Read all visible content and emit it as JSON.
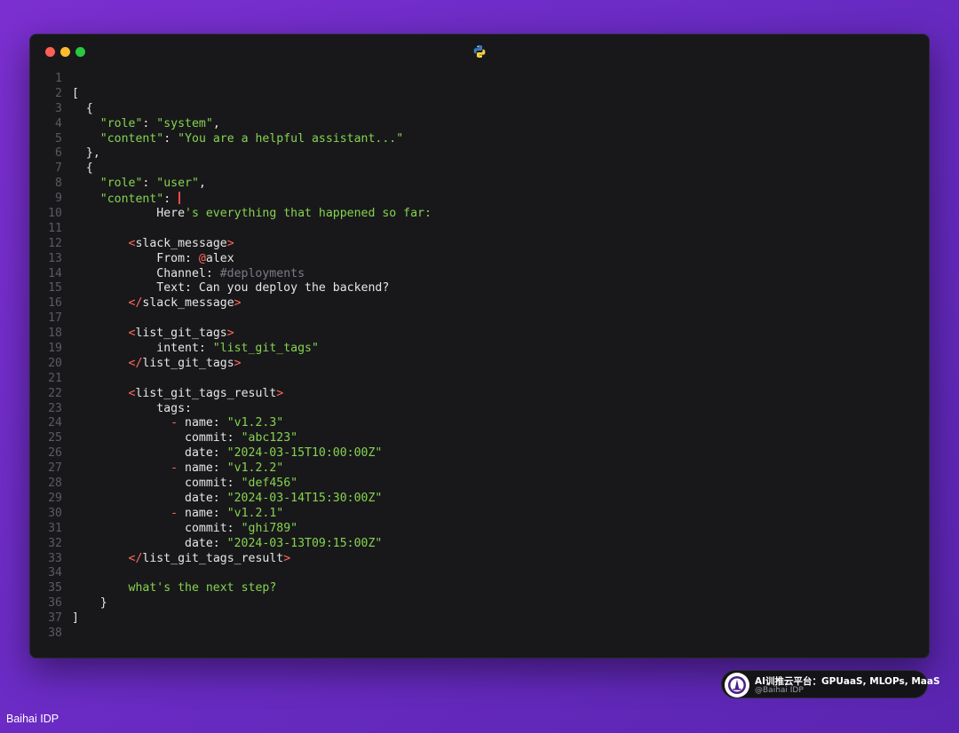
{
  "window": {
    "file_icon": "python-icon"
  },
  "code_lines": [
    {
      "n": "1",
      "parts": []
    },
    {
      "n": "2",
      "parts": [
        {
          "c": "p",
          "t": "["
        }
      ]
    },
    {
      "n": "3",
      "parts": [
        {
          "c": "p",
          "t": "  {"
        }
      ]
    },
    {
      "n": "4",
      "parts": [
        {
          "c": "p",
          "t": "    "
        },
        {
          "c": "k",
          "t": "\"role\""
        },
        {
          "c": "p",
          "t": ": "
        },
        {
          "c": "s",
          "t": "\"system\""
        },
        {
          "c": "p",
          "t": ","
        }
      ]
    },
    {
      "n": "5",
      "parts": [
        {
          "c": "p",
          "t": "    "
        },
        {
          "c": "k",
          "t": "\"content\""
        },
        {
          "c": "p",
          "t": ": "
        },
        {
          "c": "s",
          "t": "\"You are a helpful assistant...\""
        }
      ]
    },
    {
      "n": "6",
      "parts": [
        {
          "c": "p",
          "t": "  },"
        }
      ]
    },
    {
      "n": "7",
      "parts": [
        {
          "c": "p",
          "t": "  {"
        }
      ]
    },
    {
      "n": "8",
      "parts": [
        {
          "c": "p",
          "t": "    "
        },
        {
          "c": "k",
          "t": "\"role\""
        },
        {
          "c": "p",
          "t": ": "
        },
        {
          "c": "s",
          "t": "\"user\""
        },
        {
          "c": "p",
          "t": ","
        }
      ]
    },
    {
      "n": "9",
      "parts": [
        {
          "c": "p",
          "t": "    "
        },
        {
          "c": "k",
          "t": "\"content\""
        },
        {
          "c": "p",
          "t": ": "
        },
        {
          "c": "cursor",
          "t": ""
        }
      ]
    },
    {
      "n": "10",
      "parts": [
        {
          "c": "p",
          "t": "            Here"
        },
        {
          "c": "s",
          "t": "'s everything that happened so far:"
        }
      ]
    },
    {
      "n": "11",
      "parts": []
    },
    {
      "n": "12",
      "parts": [
        {
          "c": "p",
          "t": "        "
        },
        {
          "c": "t",
          "t": "<"
        },
        {
          "c": "p",
          "t": "slack_message"
        },
        {
          "c": "t",
          "t": ">"
        }
      ]
    },
    {
      "n": "13",
      "parts": [
        {
          "c": "p",
          "t": "            From: "
        },
        {
          "c": "t",
          "t": "@"
        },
        {
          "c": "p",
          "t": "alex"
        }
      ]
    },
    {
      "n": "14",
      "parts": [
        {
          "c": "p",
          "t": "            Channel: "
        },
        {
          "c": "cm",
          "t": "#deployments"
        }
      ]
    },
    {
      "n": "15",
      "parts": [
        {
          "c": "p",
          "t": "            Text: Can you deploy the backend?"
        }
      ]
    },
    {
      "n": "16",
      "parts": [
        {
          "c": "p",
          "t": "        "
        },
        {
          "c": "t",
          "t": "</"
        },
        {
          "c": "p",
          "t": "slack_message"
        },
        {
          "c": "t",
          "t": ">"
        }
      ]
    },
    {
      "n": "17",
      "parts": []
    },
    {
      "n": "18",
      "parts": [
        {
          "c": "p",
          "t": "        "
        },
        {
          "c": "t",
          "t": "<"
        },
        {
          "c": "p",
          "t": "list_git_tags"
        },
        {
          "c": "t",
          "t": ">"
        }
      ]
    },
    {
      "n": "19",
      "parts": [
        {
          "c": "p",
          "t": "            intent: "
        },
        {
          "c": "s",
          "t": "\"list_git_tags\""
        }
      ]
    },
    {
      "n": "20",
      "parts": [
        {
          "c": "p",
          "t": "        "
        },
        {
          "c": "t",
          "t": "</"
        },
        {
          "c": "p",
          "t": "list_git_tags"
        },
        {
          "c": "t",
          "t": ">"
        }
      ]
    },
    {
      "n": "21",
      "parts": []
    },
    {
      "n": "22",
      "parts": [
        {
          "c": "p",
          "t": "        "
        },
        {
          "c": "t",
          "t": "<"
        },
        {
          "c": "p",
          "t": "list_git_tags_result"
        },
        {
          "c": "t",
          "t": ">"
        }
      ]
    },
    {
      "n": "23",
      "parts": [
        {
          "c": "p",
          "t": "            tags:"
        }
      ]
    },
    {
      "n": "24",
      "parts": [
        {
          "c": "p",
          "t": "              "
        },
        {
          "c": "t",
          "t": "-"
        },
        {
          "c": "p",
          "t": " name: "
        },
        {
          "c": "s",
          "t": "\"v1.2.3\""
        }
      ]
    },
    {
      "n": "25",
      "parts": [
        {
          "c": "p",
          "t": "                commit: "
        },
        {
          "c": "s",
          "t": "\"abc123\""
        }
      ]
    },
    {
      "n": "26",
      "parts": [
        {
          "c": "p",
          "t": "                date: "
        },
        {
          "c": "s",
          "t": "\"2024-03-15T10:00:00Z\""
        }
      ]
    },
    {
      "n": "27",
      "parts": [
        {
          "c": "p",
          "t": "              "
        },
        {
          "c": "t",
          "t": "-"
        },
        {
          "c": "p",
          "t": " name: "
        },
        {
          "c": "s",
          "t": "\"v1.2.2\""
        }
      ]
    },
    {
      "n": "28",
      "parts": [
        {
          "c": "p",
          "t": "                commit: "
        },
        {
          "c": "s",
          "t": "\"def456\""
        }
      ]
    },
    {
      "n": "29",
      "parts": [
        {
          "c": "p",
          "t": "                date: "
        },
        {
          "c": "s",
          "t": "\"2024-03-14T15:30:00Z\""
        }
      ]
    },
    {
      "n": "30",
      "parts": [
        {
          "c": "p",
          "t": "              "
        },
        {
          "c": "t",
          "t": "-"
        },
        {
          "c": "p",
          "t": " name: "
        },
        {
          "c": "s",
          "t": "\"v1.2.1\""
        }
      ]
    },
    {
      "n": "31",
      "parts": [
        {
          "c": "p",
          "t": "                commit: "
        },
        {
          "c": "s",
          "t": "\"ghi789\""
        }
      ]
    },
    {
      "n": "32",
      "parts": [
        {
          "c": "p",
          "t": "                date: "
        },
        {
          "c": "s",
          "t": "\"2024-03-13T09:15:00Z\""
        }
      ]
    },
    {
      "n": "33",
      "parts": [
        {
          "c": "p",
          "t": "        "
        },
        {
          "c": "t",
          "t": "</"
        },
        {
          "c": "p",
          "t": "list_git_tags_result"
        },
        {
          "c": "t",
          "t": ">"
        }
      ]
    },
    {
      "n": "34",
      "parts": []
    },
    {
      "n": "35",
      "parts": [
        {
          "c": "p",
          "t": "        "
        },
        {
          "c": "s",
          "t": "what's the next step?"
        }
      ]
    },
    {
      "n": "36",
      "parts": [
        {
          "c": "p",
          "t": "    }"
        }
      ]
    },
    {
      "n": "37",
      "parts": [
        {
          "c": "p",
          "t": "]"
        }
      ]
    },
    {
      "n": "38",
      "parts": []
    }
  ],
  "badge": {
    "title": "AI训推云平台：GPUaaS, MLOPs, MaaS",
    "subtitle": "@Baihai IDP"
  },
  "watermark": "Baihai IDP",
  "colors": {
    "string": "#86d34e",
    "tag_bracket": "#ff6b5b",
    "comment": "#7b7b86",
    "text": "#e6e6e6",
    "line_number": "#5a5a62",
    "background": "#18181b"
  }
}
